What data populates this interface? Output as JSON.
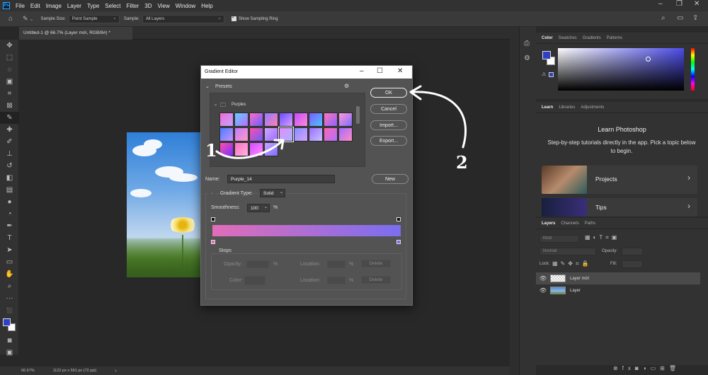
{
  "menubar": {
    "items": [
      "File",
      "Edit",
      "Image",
      "Layer",
      "Type",
      "Select",
      "Filter",
      "3D",
      "View",
      "Window",
      "Help"
    ]
  },
  "options_bar": {
    "sample_size_label": "Sample Size:",
    "sample_size_value": "Point Sample",
    "sample_label": "Sample:",
    "sample_value": "All Layers",
    "show_ring_label": "Show Sampling Ring"
  },
  "document_tab": {
    "title": "Untitled-1 @ 66.7% (Layer mới, RGB/8#) *"
  },
  "status_bar": {
    "zoom": "66.67%",
    "doc_info": "1122 px x 591 px (72 ppi)"
  },
  "color_panel": {
    "tabs": [
      "Color",
      "Swatches",
      "Gradients",
      "Patterns"
    ],
    "foreground": "#2f3fc8",
    "background": "#ffffff"
  },
  "learn_panel": {
    "tabs": [
      "Learn",
      "Libraries",
      "Adjustments"
    ],
    "title": "Learn Photoshop",
    "description": "Step-by-step tutorials directly in the app. Pick a topic below to begin.",
    "cards": [
      "Projects",
      "Tips"
    ]
  },
  "layers_panel": {
    "tabs": [
      "Layers",
      "Channels",
      "Paths"
    ],
    "search_placeholder": "Kind",
    "blend_mode": "Normal",
    "opacity_label": "Opacity:",
    "lock_label": "Lock:",
    "fill_label": "Fill:",
    "layers": [
      {
        "name": "Layer mới",
        "selected": true
      },
      {
        "name": "Layer",
        "selected": false
      }
    ]
  },
  "dialog": {
    "title": "Gradient Editor",
    "presets_label": "Presets",
    "folder_name": "Purples",
    "buttons": {
      "ok": "OK",
      "cancel": "Cancel",
      "import": "Import...",
      "export": "Export...",
      "new": "New"
    },
    "name_label": "Name:",
    "name_value": "Purple_14",
    "gradient_type_label": "Gradient Type:",
    "gradient_type_value": "Solid",
    "smoothness_label": "Smoothness:",
    "smoothness_value": "100",
    "smoothness_unit": "%",
    "stops_label": "Stops",
    "opacity_label": "Opacity:",
    "location_label": "Location:",
    "color_label": "Color:",
    "percent": "%",
    "delete_label": "Delete",
    "gradient_colors": [
      "#e16db8",
      "#7a6ef0"
    ]
  },
  "annotations": {
    "step1": "1",
    "step2": "2"
  }
}
